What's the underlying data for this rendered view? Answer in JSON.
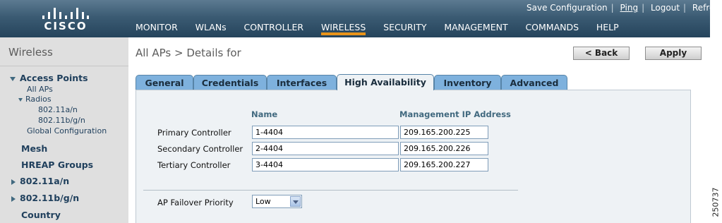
{
  "header": {
    "logo_text": "CISCO",
    "top_links": [
      "Save Configuration",
      "Ping",
      "Logout",
      "Refresh"
    ],
    "nav": [
      "MONITOR",
      "WLANs",
      "CONTROLLER",
      "WIRELESS",
      "SECURITY",
      "MANAGEMENT",
      "COMMANDS",
      "HELP"
    ],
    "active_nav": "WIRELESS"
  },
  "sidebar": {
    "title": "Wireless",
    "access_points": "Access Points",
    "all_aps": "All APs",
    "radios": "Radios",
    "radio_80211an": "802.11a/n",
    "radio_80211bgn": "802.11b/g/n",
    "global_config": "Global Configuration",
    "mesh": "Mesh",
    "hreap_groups": "HREAP Groups",
    "item_80211an": "802.11a/n",
    "item_80211bgn": "802.11b/g/n",
    "country": "Country"
  },
  "main": {
    "title": "All APs > Details for",
    "back_label": "< Back",
    "apply_label": "Apply",
    "tabs": [
      "General",
      "Credentials",
      "Interfaces",
      "High Availability",
      "Inventory",
      "Advanced"
    ],
    "active_tab": "High Availability",
    "col_name": "Name",
    "col_ip": "Management IP Address",
    "controllers": [
      {
        "label": "Primary Controller",
        "name": "1-4404",
        "ip": "209.165.200.225"
      },
      {
        "label": "Secondary Controller",
        "name": "2-4404",
        "ip": "209.165.200.226"
      },
      {
        "label": "Tertiary Controller",
        "name": "3-4404",
        "ip": "209.165.200.227"
      }
    ],
    "failover_label": "AP Failover Priority",
    "failover_value": "Low"
  },
  "figure_number": "250737",
  "colors": {
    "header": "#3b5b73",
    "tab": "#7eb1dd",
    "active_nav_underline": "#e8931a",
    "sidebar": "#dfdfdf"
  }
}
